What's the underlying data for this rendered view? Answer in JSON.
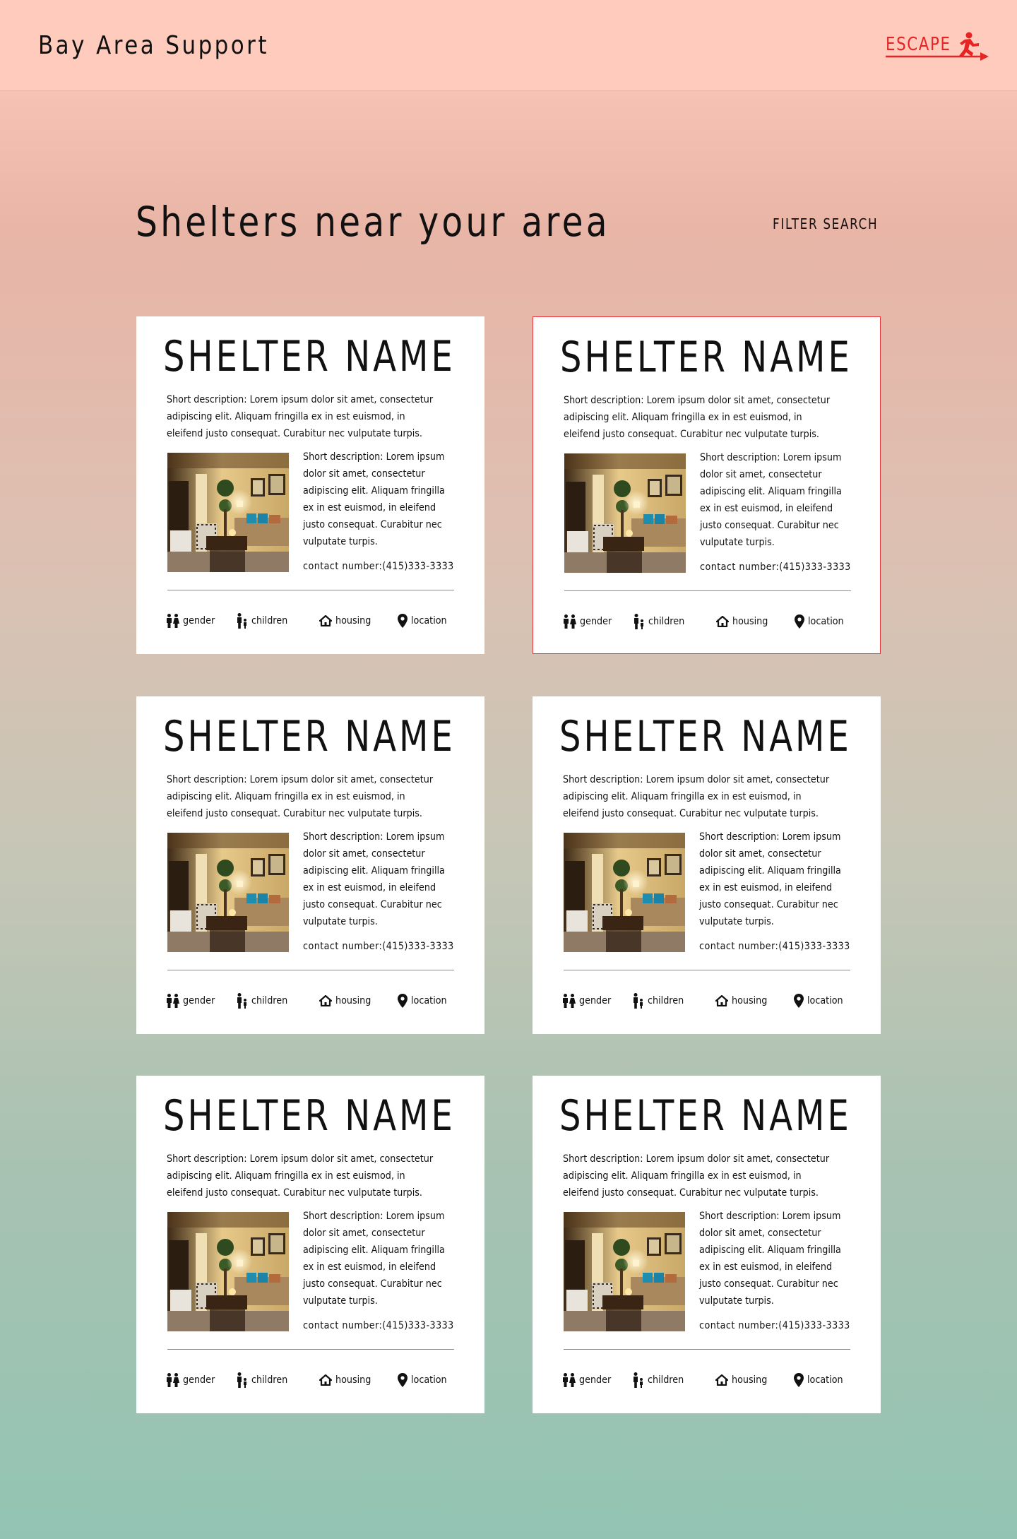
{
  "header": {
    "brand": "Bay Area Support",
    "escape_label": "ESCAPE"
  },
  "main": {
    "heading": "Shelters near your area",
    "filter_label": "FILTER SEARCH"
  },
  "colors": {
    "escape_accent": "#e82323",
    "selected_border": "#e0353b",
    "topbar": "#ffcbbd"
  },
  "icons": [
    "gender-icon",
    "children-icon",
    "housing-icon",
    "location-icon",
    "escape-runner-icon"
  ],
  "shelters": [
    {
      "name": "SHELTER NAME",
      "short_description": "Short description: Lorem ipsum dolor sit amet, consectetur adipiscing elit. Aliquam fringilla ex in est euismod, in eleifend justo consequat. Curabitur nec vulputate turpis.",
      "detail_description": "Short description: Lorem ipsum dolor sit amet, consectetur adipiscing elit. Aliquam fringilla ex in est euismod, in eleifend justo consequat. Curabitur nec vulputate turpis.",
      "contact": "contact number:(415)333-3333",
      "tags": {
        "gender": "gender",
        "children": "children",
        "housing": "housing",
        "location": "location"
      },
      "selected": false
    },
    {
      "name": "SHELTER NAME",
      "short_description": "Short description: Lorem ipsum dolor sit amet, consectetur adipiscing elit. Aliquam fringilla ex in est euismod, in eleifend justo consequat. Curabitur nec vulputate turpis.",
      "detail_description": "Short description: Lorem ipsum dolor sit amet, consectetur adipiscing elit. Aliquam fringilla ex in est euismod, in eleifend justo consequat. Curabitur nec vulputate turpis.",
      "contact": "contact number:(415)333-3333",
      "tags": {
        "gender": "gender",
        "children": "children",
        "housing": "housing",
        "location": "location"
      },
      "selected": true
    },
    {
      "name": "SHELTER NAME",
      "short_description": "Short description: Lorem ipsum dolor sit amet, consectetur adipiscing elit. Aliquam fringilla ex in est euismod, in eleifend justo consequat. Curabitur nec vulputate turpis.",
      "detail_description": "Short description: Lorem ipsum dolor sit amet, consectetur adipiscing elit. Aliquam fringilla ex in est euismod, in eleifend justo consequat. Curabitur nec vulputate turpis.",
      "contact": "contact number:(415)333-3333",
      "tags": {
        "gender": "gender",
        "children": "children",
        "housing": "housing",
        "location": "location"
      },
      "selected": false
    },
    {
      "name": "SHELTER NAME",
      "short_description": "Short description: Lorem ipsum dolor sit amet, consectetur adipiscing elit. Aliquam fringilla ex in est euismod, in eleifend justo consequat. Curabitur nec vulputate turpis.",
      "detail_description": "Short description: Lorem ipsum dolor sit amet, consectetur adipiscing elit. Aliquam fringilla ex in est euismod, in eleifend justo consequat. Curabitur nec vulputate turpis.",
      "contact": "contact number:(415)333-3333",
      "tags": {
        "gender": "gender",
        "children": "children",
        "housing": "housing",
        "location": "location"
      },
      "selected": false
    },
    {
      "name": "SHELTER NAME",
      "short_description": "Short description: Lorem ipsum dolor sit amet, consectetur adipiscing elit. Aliquam fringilla ex in est euismod, in eleifend justo consequat. Curabitur nec vulputate turpis.",
      "detail_description": "Short description: Lorem ipsum dolor sit amet, consectetur adipiscing elit. Aliquam fringilla ex in est euismod, in eleifend justo consequat. Curabitur nec vulputate turpis.",
      "contact": "contact number:(415)333-3333",
      "tags": {
        "gender": "gender",
        "children": "children",
        "housing": "housing",
        "location": "location"
      },
      "selected": false
    },
    {
      "name": "SHELTER NAME",
      "short_description": "Short description: Lorem ipsum dolor sit amet, consectetur adipiscing elit. Aliquam fringilla ex in est euismod, in eleifend justo consequat. Curabitur nec vulputate turpis.",
      "detail_description": "Short description: Lorem ipsum dolor sit amet, consectetur adipiscing elit. Aliquam fringilla ex in est euismod, in eleifend justo consequat. Curabitur nec vulputate turpis.",
      "contact": "contact number:(415)333-3333",
      "tags": {
        "gender": "gender",
        "children": "children",
        "housing": "housing",
        "location": "location"
      },
      "selected": false
    }
  ]
}
